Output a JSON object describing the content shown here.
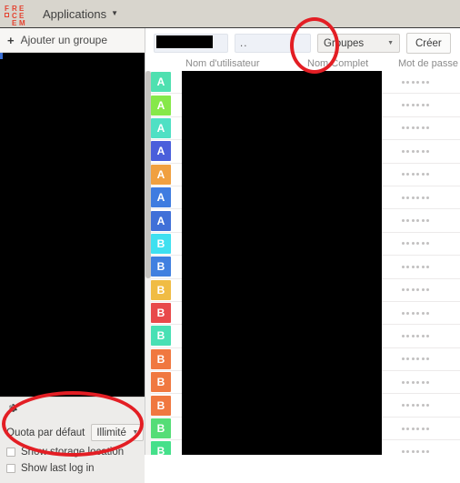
{
  "topbar": {
    "logo_rows": [
      [
        "F",
        "R",
        "E"
      ],
      [
        "□",
        "C",
        "E"
      ],
      [
        "",
        "E",
        "M"
      ]
    ],
    "logo_alt": "frecem-logo",
    "applications_label": "Applications",
    "caret": "▼"
  },
  "sidebar": {
    "add_group_label": "Ajouter un groupe",
    "add_group_icon": "plus-icon",
    "group_list_redacted": true,
    "settings": {
      "gear_icon": "gear-icon",
      "quota_label": "Quota par défaut",
      "quota_value": "Illimité",
      "quota_caret": "▼",
      "checkboxes": [
        {
          "label": "Show storage location",
          "checked": false
        },
        {
          "label": "Show last log in",
          "checked": false
        }
      ]
    }
  },
  "main": {
    "new_user": {
      "username_value": "",
      "username_placeholder": "Nom d'utilisateur",
      "fullname_value": "..",
      "fullname_placeholder": "Nom Complet",
      "groups_select_value": "Groupes",
      "groups_caret": "▼",
      "create_label": "Créer"
    },
    "columns": [
      "Nom d'utilisateur",
      "Nom Complet",
      "Mot de passe"
    ],
    "password_mask_dots": 6,
    "rows": [
      {
        "initial": "A",
        "color": "#4fe0b0",
        "username_redacted": true,
        "password_masked": true
      },
      {
        "initial": "A",
        "color": "#86e849",
        "username_redacted": true,
        "password_masked": true
      },
      {
        "initial": "A",
        "color": "#4fe0c4",
        "username_redacted": true,
        "password_masked": true
      },
      {
        "initial": "A",
        "color": "#4a5fdb",
        "username_redacted": true,
        "password_masked": true
      },
      {
        "initial": "A",
        "color": "#f0a040",
        "username_redacted": true,
        "password_masked": true
      },
      {
        "initial": "A",
        "color": "#3f7ce0",
        "username_redacted": true,
        "password_masked": true
      },
      {
        "initial": "A",
        "color": "#4070d8",
        "username_redacted": true,
        "password_masked": true
      },
      {
        "initial": "B",
        "color": "#3fe0f0",
        "username_redacted": true,
        "password_masked": true
      },
      {
        "initial": "B",
        "color": "#4080e0",
        "username_redacted": true,
        "password_masked": true
      },
      {
        "initial": "B",
        "color": "#f0bc44",
        "username_redacted": true,
        "password_masked": true
      },
      {
        "initial": "B",
        "color": "#e8494a",
        "username_redacted": true,
        "password_masked": true
      },
      {
        "initial": "B",
        "color": "#48e0b4",
        "username_redacted": true,
        "password_masked": true
      },
      {
        "initial": "B",
        "color": "#f07840",
        "username_redacted": true,
        "password_masked": true
      },
      {
        "initial": "B",
        "color": "#f07840",
        "username_redacted": true,
        "password_masked": true
      },
      {
        "initial": "B",
        "color": "#f07840",
        "username_redacted": true,
        "password_masked": true
      },
      {
        "initial": "B",
        "color": "#55dd77",
        "username_redacted": true,
        "password_masked": true
      },
      {
        "initial": "B",
        "color": "#45e08a",
        "username_redacted": true,
        "password_masked": true
      }
    ]
  },
  "annotations": {
    "accent_color": "#e31e24",
    "marks": [
      {
        "name": "highlight-groups-dropdown"
      },
      {
        "name": "highlight-quota-settings"
      }
    ]
  }
}
